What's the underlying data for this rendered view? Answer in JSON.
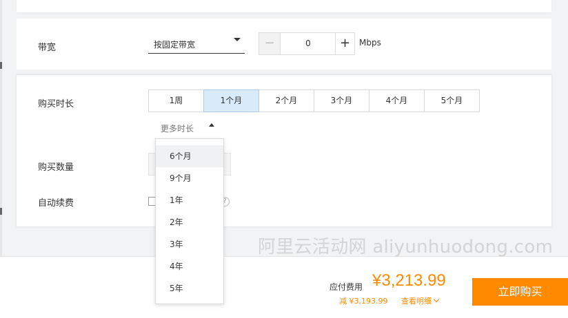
{
  "bandwidth": {
    "label": "带宽",
    "select_value": "按固定带宽",
    "stepper_value": "0",
    "minus": "−",
    "plus": "+",
    "unit": "Mbps"
  },
  "duration": {
    "label": "购买时长",
    "options": [
      "1周",
      "1个月",
      "2个月",
      "3个月",
      "4个月",
      "5个月"
    ],
    "selected": "1个月",
    "more_label": "更多时长",
    "dropdown_items": [
      "6个月",
      "9个月",
      "1年",
      "2年",
      "3年",
      "4年",
      "5年"
    ],
    "dropdown_active": "6个月"
  },
  "quantity": {
    "label": "购买数量"
  },
  "auto_renew": {
    "label": "自动续费",
    "help": "?"
  },
  "watermark": "阿里云活动网 aliyunhuodong.com",
  "footer": {
    "price_label": "应付费用",
    "price": "¥3,213.99",
    "discount": "减 ¥3,193.99",
    "details_label": "查看明细",
    "buy_button": "立即购买",
    "accent_color": "#ff8a00"
  }
}
